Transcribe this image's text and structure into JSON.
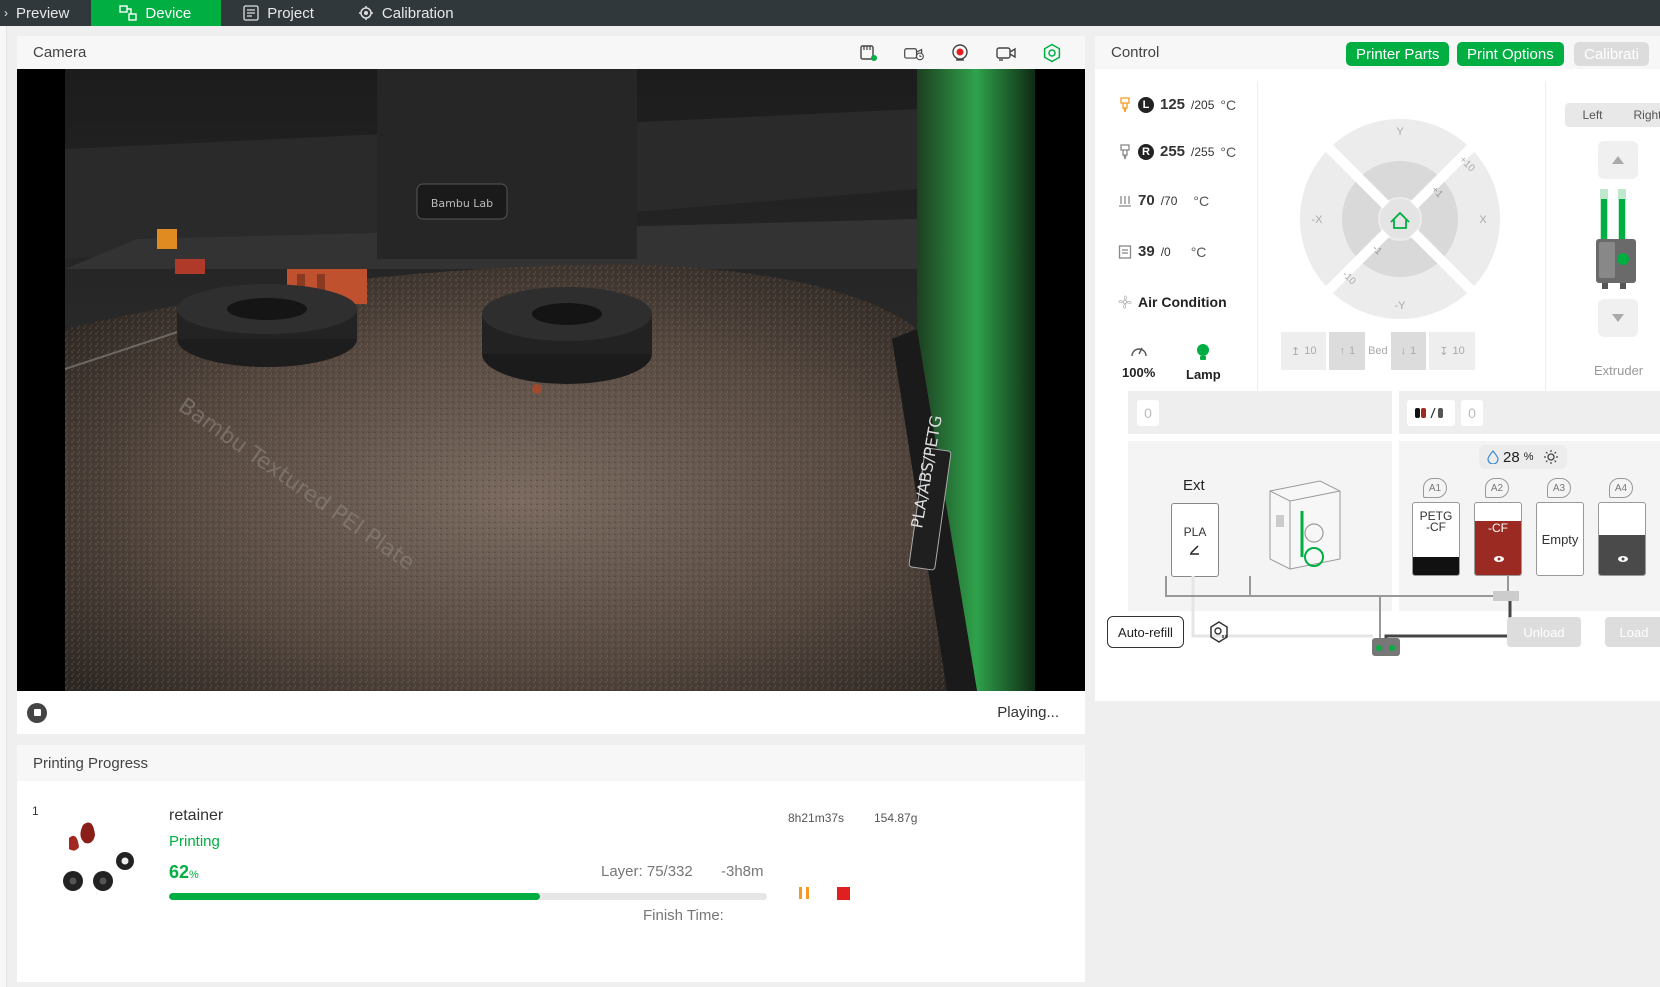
{
  "nav": {
    "tabs": [
      {
        "label": "Preview"
      },
      {
        "label": "Device"
      },
      {
        "label": "Project"
      },
      {
        "label": "Calibration"
      }
    ],
    "active_color": "#00ae42"
  },
  "camera": {
    "title": "Camera",
    "status": "Playing..."
  },
  "progress": {
    "title": "Printing Progress",
    "plate_index": "1",
    "job_name": "retainer",
    "status": "Printing",
    "percent": "62",
    "percent_sign": "%",
    "percent_value": 62,
    "print_time": "8h21m37s",
    "weight": "154.87g",
    "layer": "Layer: 75/332",
    "remaining": "-3h8m",
    "finish_time": "Finish Time:"
  },
  "control": {
    "title": "Control",
    "buttons": {
      "printer_parts": "Printer Parts",
      "print_options": "Print Options",
      "calibration": "Calibrati"
    },
    "temps": {
      "left_nozzle": {
        "tag": "L",
        "current": "125",
        "target": "/205",
        "unit": "°C"
      },
      "right_nozzle": {
        "tag": "R",
        "current": "255",
        "target": "/255",
        "unit": "°C"
      },
      "bed": {
        "current": "70",
        "target": "/70",
        "unit": "°C"
      },
      "chamber": {
        "current": "39",
        "target": "/0",
        "unit": "°C"
      },
      "air_condition": "Air Condition",
      "speed": "100%",
      "lamp": "Lamp"
    },
    "jog": {
      "y_pos": "Y",
      "y_neg": "-Y",
      "x_pos": "X",
      "x_neg": "-X",
      "plus_10": "+10",
      "plus_1": "+1",
      "minus_1": "-1",
      "minus_10": "-10"
    },
    "bed": {
      "up_10": "10",
      "up_1": "1",
      "label": "Bed",
      "down_1": "1",
      "down_10": "10"
    },
    "extruder": {
      "left": "Left",
      "right": "Right",
      "label": "Extruder"
    }
  },
  "ams": {
    "ext_slot": "0",
    "ams_slot": "0",
    "ext_label": "Ext",
    "ext_filament": "PLA",
    "humidity": "28",
    "humidity_sign": "%",
    "trays": [
      {
        "id": "A1",
        "label": "PETG\n-CF",
        "color": "#111111"
      },
      {
        "id": "A2",
        "label": "-CF",
        "color": "#9b2a22"
      },
      {
        "id": "A3",
        "label": "Empty",
        "color": "#ffffff"
      },
      {
        "id": "A4",
        "label": "",
        "color": "#4a4a4a"
      }
    ],
    "auto_refill": "Auto-refill",
    "unload": "Unload",
    "load": "Load"
  }
}
